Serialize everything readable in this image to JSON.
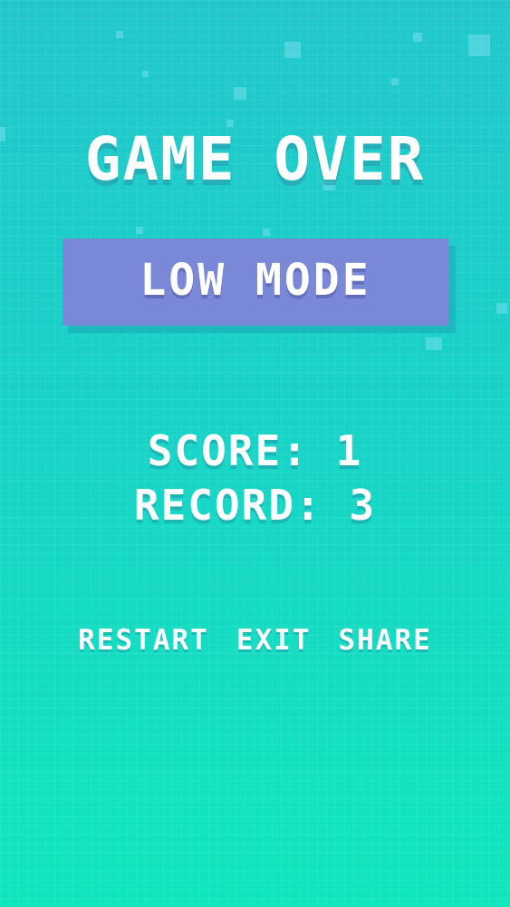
{
  "title": "GAME OVER",
  "mode": "LOW MODE",
  "score_text": "SCORE: 1",
  "record_text": "RECORD: 3",
  "actions": {
    "restart": "RESTART",
    "exit": "EXIT",
    "share": "SHARE"
  },
  "colors": {
    "background_top": "#22c7cc",
    "background_bottom": "#0fe7bd",
    "mode_box": "#7a88d8",
    "text": "#ffffff"
  }
}
